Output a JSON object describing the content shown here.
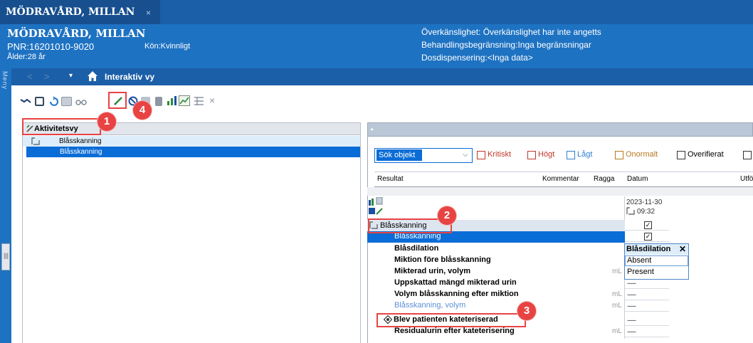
{
  "window": {
    "tab_title": "MÖDRAVÅRD, MILLAN",
    "tab_close": "×"
  },
  "patient": {
    "name": "MÖDRAVÅRD, MILLAN",
    "pnr": "PNR:16201010-9020",
    "age": "Ålder:28 år",
    "gender": "Kön:Kvinnligt",
    "hypersensitivity": "Överkänslighet: Överkänslighet har inte angetts",
    "treatment_limit": "Behandlingsbegränsning:Inga begränsningar",
    "dose_dispensing": "Dosdispensering:<Inga data>"
  },
  "sidebar": {
    "label": "Meny",
    "handle": "|||"
  },
  "nav": {
    "back": "<",
    "forward": ">",
    "dropdown": "▾",
    "title": "Interaktiv vy"
  },
  "toolbar": {
    "icons": [
      "link-icon",
      "grid-icon",
      "refresh-icon",
      "card-icon",
      "glasses-icon",
      "pen-icon",
      "block-icon",
      "copy-icon",
      "print-icon",
      "chart-icon",
      "graph-icon",
      "table-icon",
      "close-icon"
    ],
    "close_glyph": "×"
  },
  "left_panel": {
    "title": "Aktivitetsvy",
    "rows": [
      "Blåsskanning",
      "Blåsskanning"
    ]
  },
  "right_panel": {
    "arrow": "◂",
    "search": {
      "value": "Sök objekt",
      "chevron": "⌵"
    },
    "filters": [
      "Kritiskt",
      "Högt",
      "Lågt",
      "Onormalt",
      "Overifierat"
    ],
    "columns": [
      "Resultat",
      "Kommentar",
      "Ragga",
      "Datum",
      "Utförd"
    ],
    "date": "2023-11-30",
    "time": "09:32",
    "tree": {
      "group": "Blåsskanning",
      "selected": "Blåsskanning",
      "items": [
        {
          "label": "Blåsdilation",
          "unit": "",
          "value": ""
        },
        {
          "label": "Miktion före blåsskanning",
          "unit": "",
          "value": ""
        },
        {
          "label": "Mikterad urin, volym",
          "unit": "mL",
          "value": "------"
        },
        {
          "label": "Uppskattad mängd mikterad urin",
          "unit": "",
          "value": "------"
        },
        {
          "label": "Volym blåsskanning efter miktion",
          "unit": "mL",
          "value": "------"
        },
        {
          "label": "Blåsskanning, volym",
          "unit": "mL",
          "value": "------"
        },
        {
          "label": "Blev patienten kateteriserad",
          "unit": "",
          "value": "------"
        },
        {
          "label": "Residualurin efter kateterisering",
          "unit": "mL",
          "value": "------"
        }
      ]
    },
    "check_mark": "✓"
  },
  "popup": {
    "title": "Blåsdilation",
    "close": "✕",
    "options": [
      "Absent",
      "Present"
    ]
  },
  "annotations": [
    "1",
    "2",
    "3",
    "4"
  ],
  "colors": {
    "title_bar": "#1b5fa8",
    "header": "#1e72c2",
    "selection": "#0a6cd6",
    "annotation": "#e84343"
  }
}
